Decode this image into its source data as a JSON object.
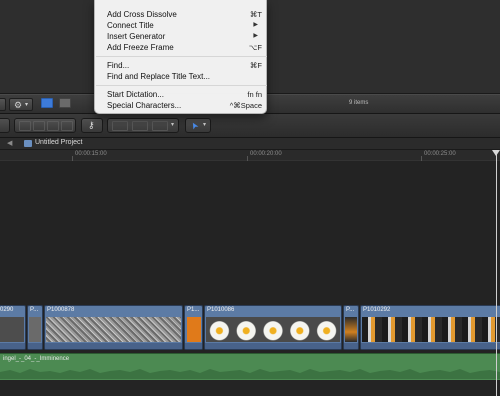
{
  "browser": {
    "items_count": "9 items"
  },
  "project": {
    "title": "Untitled Project"
  },
  "ruler": {
    "timecodes": [
      "00:00:15:00",
      "00:00:20:00",
      "00:00:25:00"
    ]
  },
  "clips": [
    {
      "label": "0290",
      "thumb_style": "dark"
    },
    {
      "label": "P...",
      "thumb_style": "dark"
    },
    {
      "label": "P1000878",
      "thumb_style": "gravel"
    },
    {
      "label": "P1...",
      "thumb_style": "orange"
    },
    {
      "label": "P1010086",
      "thumb_style": "egg"
    },
    {
      "label": "P...",
      "thumb_style": "pan"
    },
    {
      "label": "P1010292",
      "thumb_style": "pan"
    }
  ],
  "audio": {
    "label": "ingel_-_04_-_Imminence"
  },
  "context_menu": {
    "items": [
      {
        "label": "Add Cross Dissolve",
        "shortcut": "⌘T",
        "submenu": false
      },
      {
        "label": "Connect Title",
        "shortcut": "",
        "submenu": true
      },
      {
        "label": "Insert Generator",
        "shortcut": "",
        "submenu": true
      },
      {
        "label": "Add Freeze Frame",
        "shortcut": "⌥F",
        "submenu": false
      },
      {
        "label": "Find...",
        "shortcut": "⌘F",
        "submenu": false
      },
      {
        "label": "Find and Replace Title Text...",
        "shortcut": "",
        "submenu": false
      },
      {
        "label": "Start Dictation...",
        "shortcut": "fn fn",
        "submenu": false
      },
      {
        "label": "Special Characters...",
        "shortcut": "^⌘Space",
        "submenu": false
      }
    ],
    "submenu_arrow": "▶"
  },
  "icons": {
    "gear": "⚙",
    "chevron_down": "▾",
    "back": "◀",
    "pointer": "➤"
  },
  "colors": {
    "clip": "#5c7ba5",
    "audio": "#4c8a52",
    "accent_blue": "#3d7bd9"
  }
}
